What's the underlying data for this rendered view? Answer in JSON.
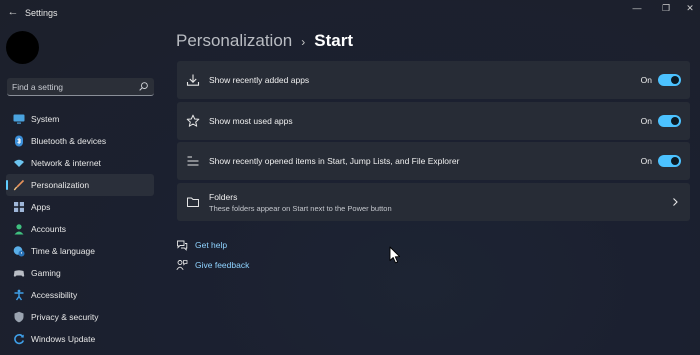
{
  "window": {
    "title": "Settings",
    "back_glyph": "←",
    "minimize_glyph": "—",
    "maximize_glyph": "❐",
    "close_glyph": "✕"
  },
  "search": {
    "placeholder": "Find a setting",
    "value": "",
    "icon": "search-icon"
  },
  "sidebar": {
    "items": [
      {
        "label": "System",
        "icon": "monitor-icon",
        "color": "#4aa3df"
      },
      {
        "label": "Bluetooth & devices",
        "icon": "bluetooth-icon",
        "color": "#3b8fd9"
      },
      {
        "label": "Network & internet",
        "icon": "wifi-icon",
        "color": "#6cc4f0"
      },
      {
        "label": "Personalization",
        "icon": "paintbrush-icon",
        "color": "#e8935a",
        "selected": true
      },
      {
        "label": "Apps",
        "icon": "apps-icon",
        "color": "#9fb6d8"
      },
      {
        "label": "Accounts",
        "icon": "person-icon",
        "color": "#3fbf7f"
      },
      {
        "label": "Time & language",
        "icon": "globe-clock-icon",
        "color": "#5aaee8"
      },
      {
        "label": "Gaming",
        "icon": "gamepad-icon",
        "color": "#b8bcc4"
      },
      {
        "label": "Accessibility",
        "icon": "accessibility-icon",
        "color": "#3f9fe8"
      },
      {
        "label": "Privacy & security",
        "icon": "shield-icon",
        "color": "#9aa3b0"
      },
      {
        "label": "Windows Update",
        "icon": "windows-update-icon",
        "color": "#3f9fe8"
      }
    ],
    "accent": "#60cdff"
  },
  "header": {
    "parent": "Personalization",
    "separator": "›",
    "current": "Start"
  },
  "settings": [
    {
      "title": "Show recently added apps",
      "state": "On",
      "icon": "download-icon",
      "enabled": true
    },
    {
      "title": "Show most used apps",
      "state": "On",
      "icon": "star-icon",
      "enabled": true
    },
    {
      "title": "Show recently opened items in Start, Jump Lists, and File Explorer",
      "state": "On",
      "icon": "list-icon",
      "enabled": true
    }
  ],
  "folders": {
    "title": "Folders",
    "subtitle": "These folders appear on Start next to the Power button",
    "icon": "folder-icon"
  },
  "links": {
    "help": "Get help",
    "feedback": "Give feedback"
  },
  "colors": {
    "toggle_on": "#4cc2ff",
    "link": "#8fd3ff",
    "card": "#272c36"
  }
}
